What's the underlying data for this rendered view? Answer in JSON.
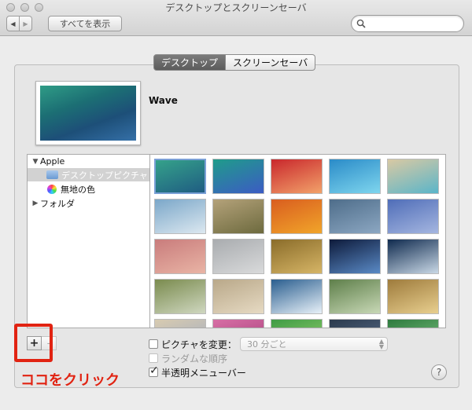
{
  "window": {
    "title": "デスクトップとスクリーンセーバ"
  },
  "toolbar": {
    "back_label": "◀",
    "forward_label": "▶",
    "show_all_label": "すべてを表示",
    "search_placeholder": ""
  },
  "tabs": [
    {
      "label": "デスクトップ",
      "active": true
    },
    {
      "label": "スクリーンセーバ",
      "active": false
    }
  ],
  "current_wallpaper": {
    "name": "Wave"
  },
  "sidebar": {
    "items": [
      {
        "label": "Apple",
        "expanded": true
      },
      {
        "label": "デスクトップピクチャ",
        "selected": true
      },
      {
        "label": "無地の色"
      },
      {
        "label": "フォルダ",
        "expanded": false
      }
    ]
  },
  "thumbnails": [
    {
      "name": "wave",
      "colors": [
        "#35a28a",
        "#1f5c82"
      ]
    },
    {
      "name": "blue-green-paint",
      "colors": [
        "#1f9c8a",
        "#3c5bc4"
      ]
    },
    {
      "name": "red-canyon",
      "colors": [
        "#c9272c",
        "#f2a26a"
      ]
    },
    {
      "name": "blue-water",
      "colors": [
        "#2a8bc8",
        "#7fd6ee"
      ]
    },
    {
      "name": "beach-shore",
      "colors": [
        "#d9c9a3",
        "#5ab5c9"
      ]
    },
    {
      "name": "blue-tree-forest",
      "colors": [
        "#7ba7c9",
        "#dce8f0"
      ]
    },
    {
      "name": "grass-close",
      "colors": [
        "#b4a27a",
        "#6d6a3e"
      ]
    },
    {
      "name": "autumn-leaves",
      "colors": [
        "#d95d1f",
        "#f1a52a"
      ]
    },
    {
      "name": "dark-water-ripple",
      "colors": [
        "#4e6d8a",
        "#8ca7c2"
      ]
    },
    {
      "name": "blue-waves-texture",
      "colors": [
        "#4f6db8",
        "#a5b6e0"
      ]
    },
    {
      "name": "pink-sand",
      "colors": [
        "#c97c7c",
        "#e9b4a5"
      ]
    },
    {
      "name": "foggy-lake",
      "colors": [
        "#a9acaf",
        "#d9dadb"
      ]
    },
    {
      "name": "golden-field-bird",
      "colors": [
        "#8a6c2a",
        "#d6b566"
      ]
    },
    {
      "name": "earth-from-space",
      "colors": [
        "#0d1a3a",
        "#5a8ac6"
      ]
    },
    {
      "name": "earth-horizon",
      "colors": [
        "#0f2a4e",
        "#c9d8e6"
      ]
    },
    {
      "name": "elephant-savanna",
      "colors": [
        "#7a8b4e",
        "#cfd7c0"
      ]
    },
    {
      "name": "plains-herd",
      "colors": [
        "#b9a889",
        "#e6dac3"
      ]
    },
    {
      "name": "ice-cracks",
      "colors": [
        "#2a5e8f",
        "#e8f1f8"
      ]
    },
    {
      "name": "lily-pads",
      "colors": [
        "#5e7f4a",
        "#c8d8b6"
      ]
    },
    {
      "name": "desert-sunrays",
      "colors": [
        "#9e7b3c",
        "#e8cf8f"
      ]
    },
    {
      "name": "dunes-pastel",
      "colors": [
        "#d8cbb0",
        "#9eaac2"
      ]
    },
    {
      "name": "pink-flowers",
      "colors": [
        "#d76fa5",
        "#a53e7a"
      ]
    },
    {
      "name": "green-bands",
      "colors": [
        "#3f9b45",
        "#9bd46f"
      ]
    },
    {
      "name": "dark-water",
      "colors": [
        "#2b3a4d",
        "#5d7290"
      ]
    },
    {
      "name": "green-leaves",
      "colors": [
        "#2e7a3e",
        "#81c783"
      ]
    }
  ],
  "controls": {
    "add_button": "+",
    "remove_button": "-",
    "change_picture_label": "ピクチャを変更：",
    "change_picture_checked": false,
    "interval_value": "30 分ごと",
    "random_order_label": "ランダムな順序",
    "random_order_checked": false,
    "translucent_menu_label": "半透明メニューバー",
    "translucent_menu_checked": true,
    "help_label": "?"
  },
  "annotation": {
    "text": "ココをクリック",
    "color": "#e12312"
  }
}
